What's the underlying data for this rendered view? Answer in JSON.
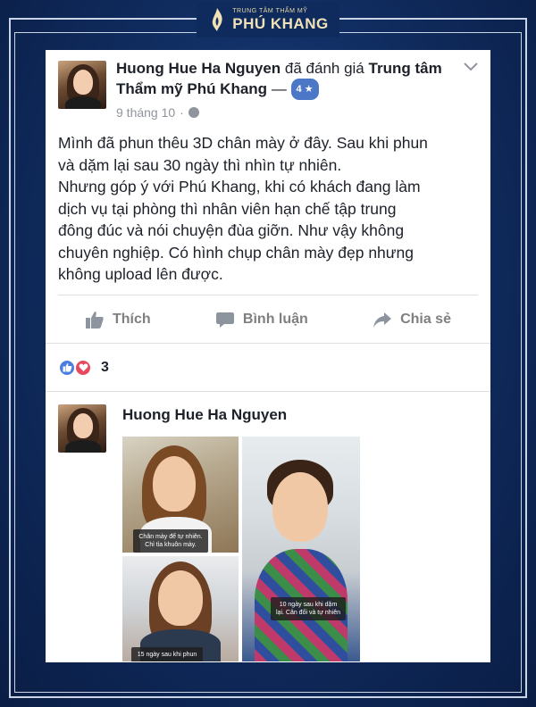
{
  "brand": {
    "subtitle": "TRUNG TÂM THẨM MỸ",
    "name": "PHÚ KHANG"
  },
  "post": {
    "author": "Huong Hue Ha Nguyen",
    "action": "đã đánh giá",
    "page_name": "Trung tâm Thẩm mỹ Phú Khang",
    "separator": "—",
    "rating": "4 ★",
    "date": "9 tháng 10",
    "dot": "·",
    "body_lines": [
      "Mình đã phun thêu 3D chân mày ở đây. Sau khi phun",
      "và dặm lại sau 30 ngày thì nhìn tự nhiên.",
      "Nhưng góp ý với Phú Khang, khi có khách đang làm",
      "dịch vụ tại phòng thì nhân viên hạn chế tập trung",
      "đông đúc và nói chuyện đùa giỡn. Như vậy không",
      "chuyên nghiệp. Có hình chụp chân mày đẹp nhưng",
      "không upload lên được."
    ]
  },
  "actions": {
    "like": "Thích",
    "comment": "Bình luận",
    "share": "Chia sẻ"
  },
  "reactions": {
    "count": "3"
  },
  "comment": {
    "author": "Huong Hue Ha Nguyen",
    "captions": {
      "photo1": "Chân mày để tự nhiên. Chỉ tỉa khuôn mày.",
      "photo2": "10 ngày sau khi dặm lại. Cân đối và tự nhiên",
      "photo3": "15 ngày sau khi phun"
    }
  },
  "colors": {
    "background": "#0f2a5c",
    "brand_gold": "#f0e2b6",
    "facebook_blue": "#4c76c6",
    "love_red": "#e9485d"
  }
}
